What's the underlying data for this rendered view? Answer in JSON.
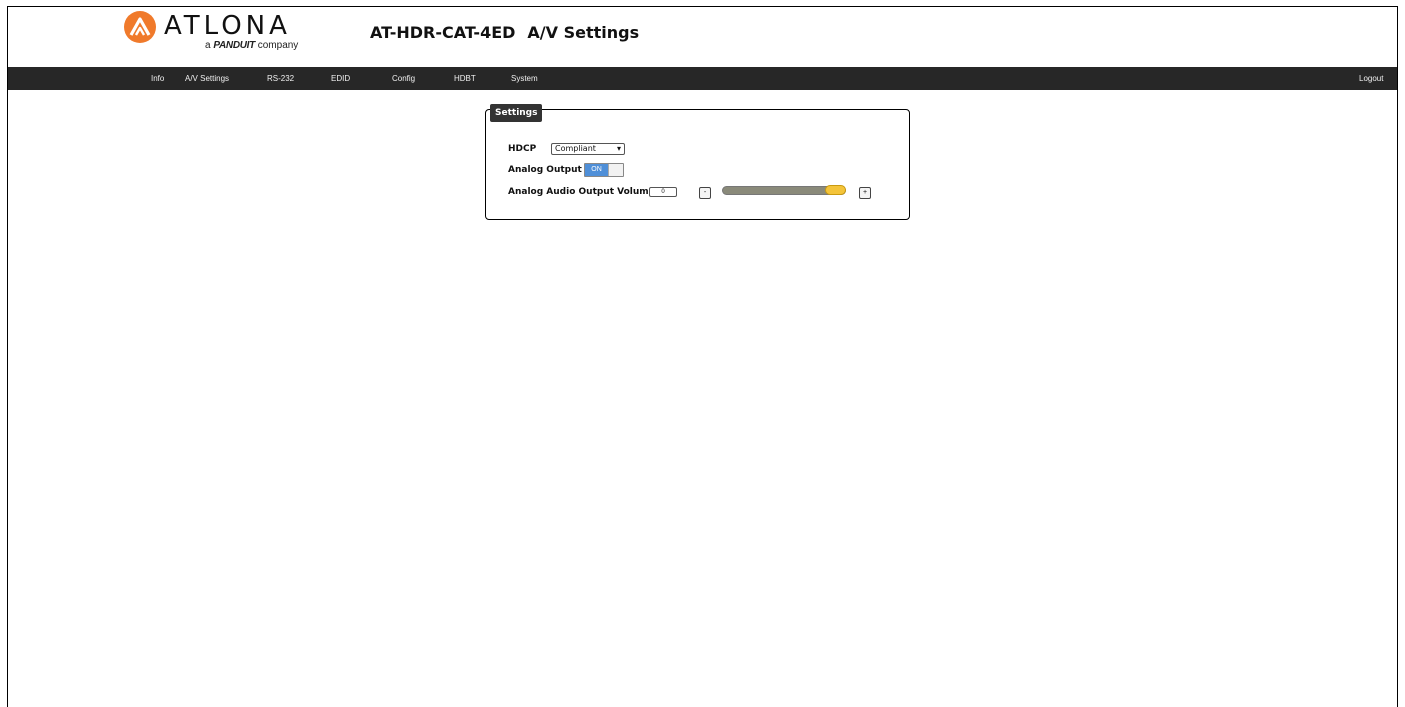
{
  "header": {
    "logo_wordmark": "ATLONA",
    "logo_sub_prefix": "a",
    "logo_sub_brand": "PANDUIT",
    "logo_sub_suffix": "company",
    "model": "AT-HDR-CAT-4ED",
    "page": "A/V Settings"
  },
  "nav": {
    "items": [
      {
        "label": "Info"
      },
      {
        "label": "A/V Settings"
      },
      {
        "label": "RS-232"
      },
      {
        "label": "EDID"
      },
      {
        "label": "Config"
      },
      {
        "label": "HDBT"
      },
      {
        "label": "System"
      }
    ],
    "logout": "Logout"
  },
  "settings": {
    "legend": "Settings",
    "hdcp": {
      "label": "HDCP",
      "value": "Compliant"
    },
    "analog_output": {
      "label": "Analog Output",
      "state": "ON"
    },
    "volume": {
      "label": "Analog Audio Output Volume",
      "value": "0",
      "minus_label": "-",
      "plus_label": "+",
      "level_fraction": 1.0
    }
  },
  "colors": {
    "navbar": "#272727",
    "logo_accent": "#f07a2b",
    "toggle_on": "#4f8fd8",
    "slider_thumb": "#f4c43a"
  }
}
